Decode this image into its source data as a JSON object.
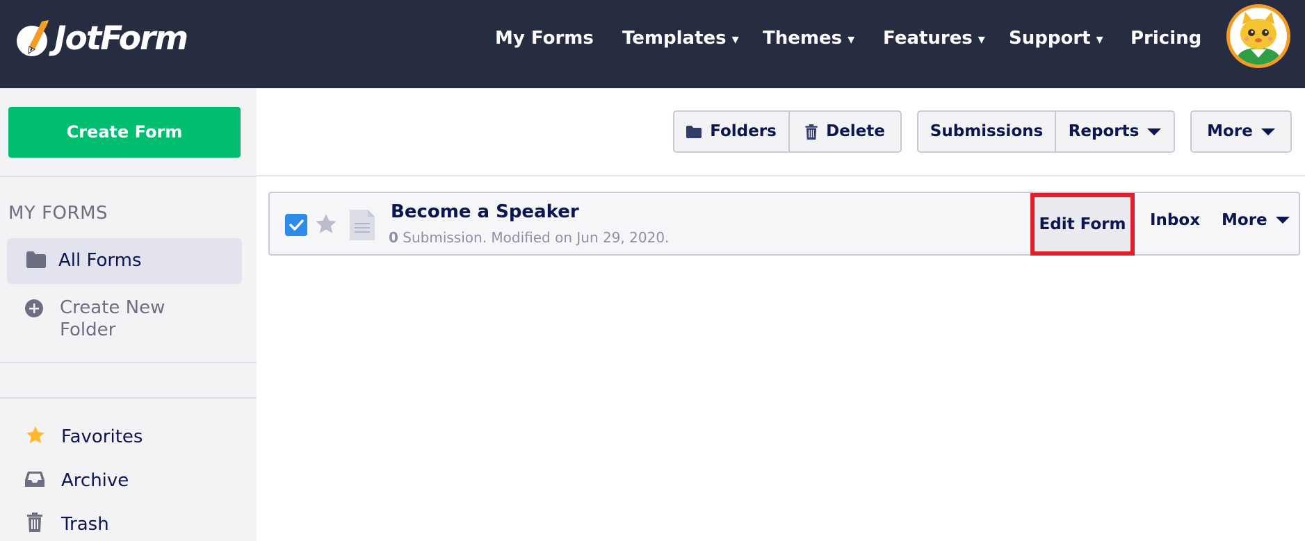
{
  "brand": {
    "name": "JotForm",
    "accent": "#01bd6f",
    "nav_bg": "#262d41",
    "highlight": "#e21e2c"
  },
  "topnav": {
    "items": [
      {
        "label": "My Forms",
        "has_caret": false
      },
      {
        "label": "Templates",
        "has_caret": true
      },
      {
        "label": "Themes",
        "has_caret": true
      },
      {
        "label": "Features",
        "has_caret": true
      },
      {
        "label": "Support",
        "has_caret": true
      },
      {
        "label": "Pricing",
        "has_caret": false
      }
    ],
    "caret": "▾",
    "avatar_icon": "cat-avatar-icon"
  },
  "sidebar": {
    "create_label": "Create Form",
    "heading": "MY FORMS",
    "all_forms": "All Forms",
    "create_folder": "Create New Folder",
    "items": [
      {
        "label": "Favorites",
        "icon": "star-icon"
      },
      {
        "label": "Archive",
        "icon": "inbox-icon"
      },
      {
        "label": "Trash",
        "icon": "trash-icon"
      }
    ]
  },
  "toolbar": {
    "folders": "Folders",
    "delete": "Delete",
    "submissions": "Submissions",
    "reports": "Reports",
    "more": "More"
  },
  "form": {
    "title": "Become a Speaker",
    "submission_count": "0",
    "meta_text": " Submission. Modified on Jun 29, 2020.",
    "checked": true,
    "starred": false,
    "edit_label": "Edit Form",
    "inbox_label": "Inbox",
    "more_label": "More"
  }
}
